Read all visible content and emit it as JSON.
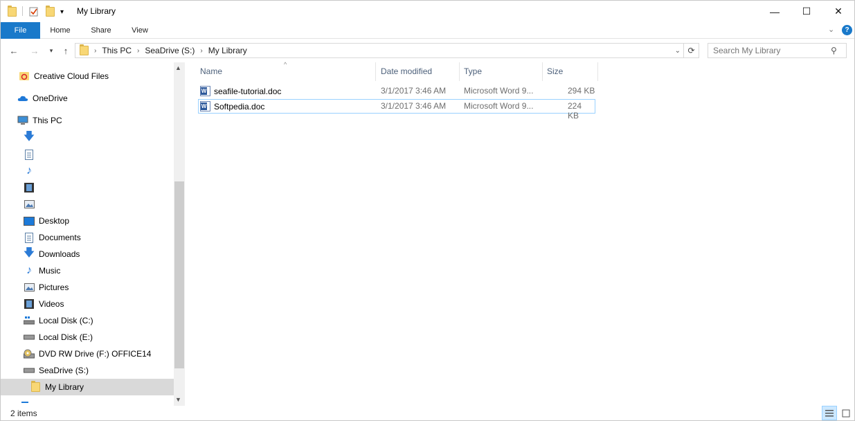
{
  "window": {
    "title": "My Library",
    "minimize": "—",
    "maximize": "☐",
    "close": "✕"
  },
  "ribbon": {
    "tabs": [
      "File",
      "Home",
      "Share",
      "View"
    ],
    "help": "?"
  },
  "address": {
    "crumbs": [
      "This PC",
      "SeaDrive (S:)",
      "My Library"
    ],
    "search_placeholder": "Search My Library"
  },
  "nav": {
    "top_items": [
      {
        "label": "Creative Cloud Files",
        "icon": "creative-cloud-icon"
      },
      {
        "label": "OneDrive",
        "icon": "onedrive-cloud-icon"
      },
      {
        "label": "This PC",
        "icon": "computer-icon"
      }
    ],
    "quick_icons": [
      "downloads-icon",
      "documents-icon",
      "music-icon",
      "videos-icon",
      "pictures-icon"
    ],
    "pc_items": [
      {
        "label": "Desktop",
        "icon": "desktop-icon"
      },
      {
        "label": "Documents",
        "icon": "documents-icon"
      },
      {
        "label": "Downloads",
        "icon": "downloads-icon"
      },
      {
        "label": "Music",
        "icon": "music-icon"
      },
      {
        "label": "Pictures",
        "icon": "pictures-icon"
      },
      {
        "label": "Videos",
        "icon": "videos-icon"
      },
      {
        "label": "Local Disk (C:)",
        "icon": "system-drive-icon"
      },
      {
        "label": "Local Disk (E:)",
        "icon": "drive-icon"
      },
      {
        "label": "DVD RW Drive (F:) OFFICE14",
        "icon": "dvd-drive-icon"
      },
      {
        "label": "SeaDrive (S:)",
        "icon": "drive-icon"
      },
      {
        "label": "My Library",
        "icon": "folder-icon"
      }
    ]
  },
  "columns": [
    "Name",
    "Date modified",
    "Type",
    "Size"
  ],
  "files": [
    {
      "name": "seafile-tutorial.doc",
      "date": "3/1/2017 3:46 AM",
      "type": "Microsoft Word 9...",
      "size": "294 KB"
    },
    {
      "name": "Softpedia.doc",
      "date": "3/1/2017 3:46 AM",
      "type": "Microsoft Word 9...",
      "size": "224 KB"
    }
  ],
  "status": {
    "items": "2 items"
  },
  "colors": {
    "accent": "#1979ca",
    "selection": "#cce8ff",
    "selection_border": "#99d1ff",
    "header_text": "#4c607a"
  }
}
